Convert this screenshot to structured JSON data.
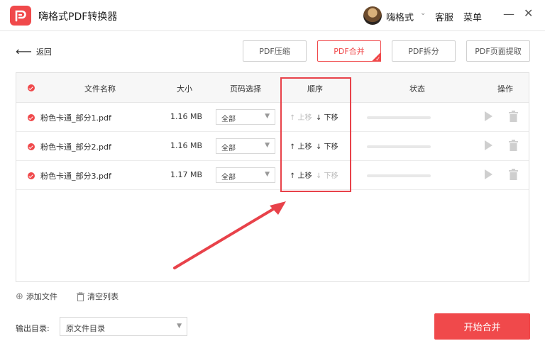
{
  "app": {
    "title": "嗨格式PDF转换器",
    "accent_color": "#f0494b"
  },
  "user": {
    "name": "嗨格式"
  },
  "titlebar_links": {
    "service": "客服",
    "menu": "菜单"
  },
  "window_controls": {
    "minimize": "—",
    "close": "✕"
  },
  "back": {
    "label": "返回"
  },
  "tabs": [
    {
      "label": "PDF压缩",
      "active": false
    },
    {
      "label": "PDF合并",
      "active": true
    },
    {
      "label": "PDF拆分",
      "active": false
    },
    {
      "label": "PDF页面提取",
      "active": false
    }
  ],
  "table": {
    "headers": {
      "name": "文件名称",
      "size": "大小",
      "pages": "页码选择",
      "order": "顺序",
      "status": "状态",
      "action": "操作"
    },
    "rows": [
      {
        "name": "粉色卡通_部分1.pdf",
        "size": "1.16 MB",
        "pages": "全部",
        "up": "↑ 上移",
        "down": "↓ 下移",
        "up_enabled": false,
        "down_enabled": true,
        "progress": 0
      },
      {
        "name": "粉色卡通_部分2.pdf",
        "size": "1.16 MB",
        "pages": "全部",
        "up": "↑ 上移",
        "down": "↓ 下移",
        "up_enabled": true,
        "down_enabled": true,
        "progress": 0
      },
      {
        "name": "粉色卡通_部分3.pdf",
        "size": "1.17 MB",
        "pages": "全部",
        "up": "↑ 上移",
        "down": "↓ 下移",
        "up_enabled": true,
        "down_enabled": false,
        "progress": 0
      }
    ]
  },
  "footer": {
    "add_file": "添加文件",
    "clear_list": "清空列表"
  },
  "output": {
    "label": "输出目录:",
    "value": "原文件目录"
  },
  "start_button": "开始合并",
  "icons": [
    "app-logo-icon",
    "back-arrow-icon",
    "check-icon",
    "caret-down-icon",
    "play-icon",
    "trash-icon",
    "add-circle-icon",
    "trash-small-icon"
  ]
}
